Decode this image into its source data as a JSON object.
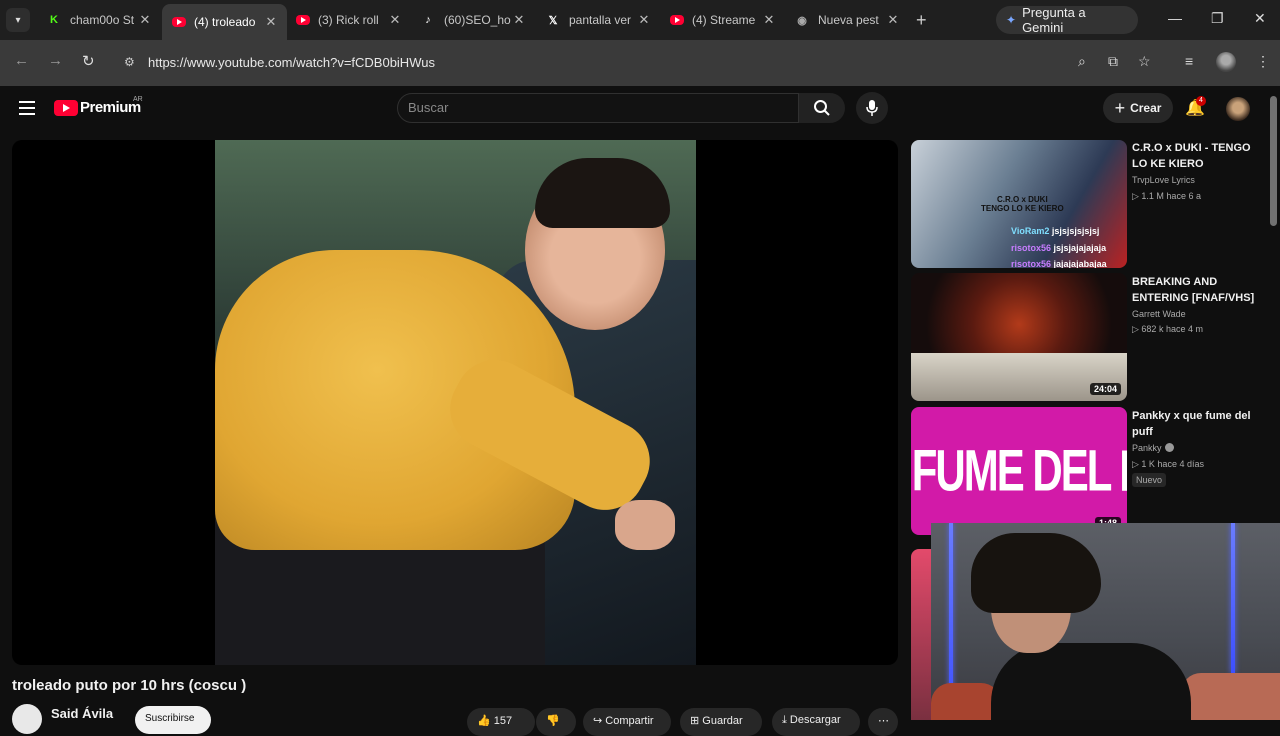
{
  "browser": {
    "tabs": [
      {
        "title": "cham00o St",
        "favicon": "kick-icon"
      },
      {
        "title": "(4) troleado",
        "favicon": "youtube-icon",
        "active": true
      },
      {
        "title": "(3) Rick roll",
        "favicon": "youtube-icon"
      },
      {
        "title": "(60)SEO_ho",
        "favicon": "tiktok-icon"
      },
      {
        "title": "pantalla ver",
        "favicon": "x-icon"
      },
      {
        "title": "(4) Streame",
        "favicon": "youtube-icon"
      },
      {
        "title": "Nueva pest",
        "favicon": "chrome-icon"
      }
    ],
    "gemini_label": "Pregunta a Gemini",
    "url": "https://www.youtube.com/watch?v=fCDB0biHWus"
  },
  "youtube": {
    "logo_text": "Premium",
    "region": "AR",
    "search_placeholder": "Buscar",
    "create_label": "Crear",
    "notification_count": "4"
  },
  "video": {
    "title": "troleado puto por 10 hrs (coscu )",
    "channel": "Said Ávila",
    "subscribe_label": "Suscribirse",
    "like_count": "157",
    "share_label": "Compartir",
    "save_label": "Guardar",
    "download_label": "Descargar"
  },
  "recommendations": [
    {
      "title": "C.R.O x DUKI - TENGO LO KE KIERO",
      "channel": "TrvpLove Lyrics",
      "meta": "1.1 M  hace 6 a",
      "thumb_text": "C.R.O x DUKI\nTENGO LO KE KIERO",
      "chat": [
        {
          "user": "VioRam2",
          "msg": "jsjsjsjsjsjsj",
          "color": "#7fdfff"
        },
        {
          "user": "risotox56",
          "msg": "jsjsjajajajaja",
          "color": "#c77dff"
        },
        {
          "user": "risotox56",
          "msg": "jajajajabajaa",
          "color": "#c77dff"
        }
      ]
    },
    {
      "title": "BREAKING AND ENTERING [FNAF/VHS]",
      "channel": "Garrett Wade",
      "meta": "682 k  hace 4 m",
      "duration": "24:04"
    },
    {
      "title": "Pankky x que fume del puff",
      "channel": "Pankky",
      "meta": "1 K  hace 4 días",
      "badge": "Nuevo",
      "thumb_text": "QUE FUME DEL PUFF",
      "duration": "1:48"
    }
  ],
  "colors": {
    "youtube_red": "#ff0033",
    "thumb_pink": "#d21aa8",
    "background": "#0f0f0f"
  }
}
